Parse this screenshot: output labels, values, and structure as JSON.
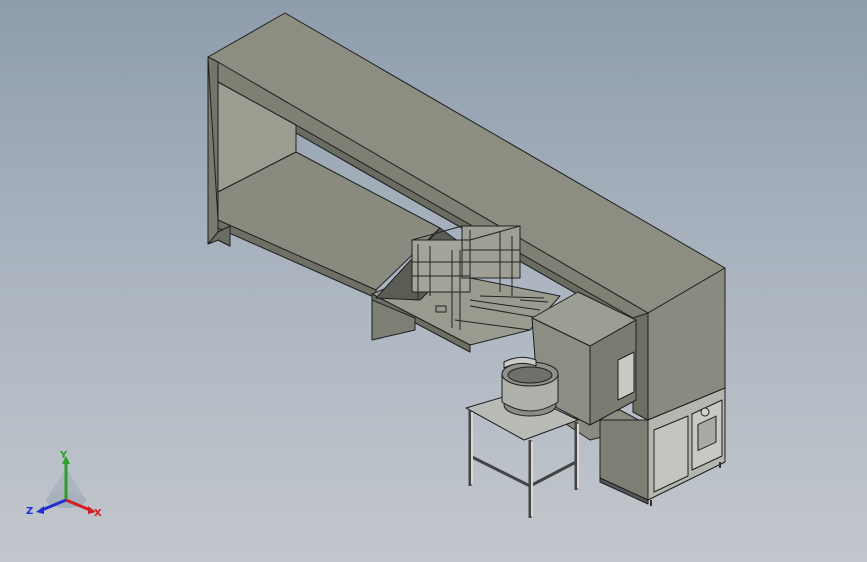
{
  "viewport": {
    "background_top": "#8e9cac",
    "background_bottom": "#c3c7cd",
    "model_colors": {
      "frame_top": "#8c8d80",
      "frame_front": "#7f8074",
      "frame_side": "#6f7065",
      "inner": "#9a9b8f",
      "shelf": "#8a8b7f",
      "edge": "#1f1f1f",
      "steel": "#c9cbc6",
      "cabinet": "#8a8b80"
    }
  },
  "triad": {
    "y_label": "Y",
    "z_label": "Z",
    "x_label": "X",
    "y_color": "#2aa02a",
    "x_color": "#d02020",
    "z_color": "#2030d0"
  }
}
